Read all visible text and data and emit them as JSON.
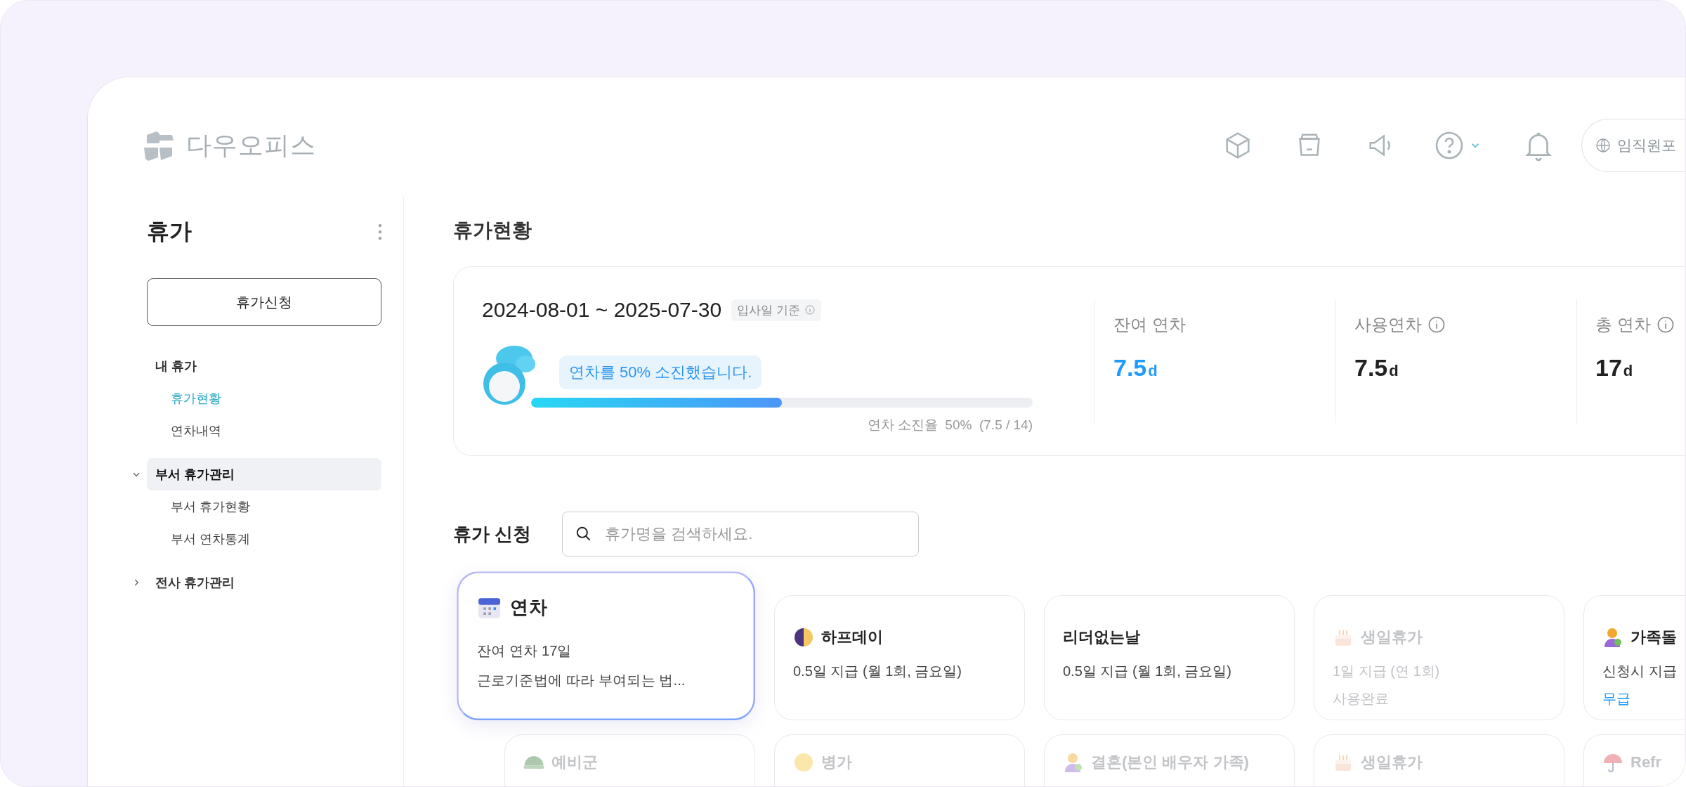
{
  "header": {
    "logo": "다우오피스",
    "portal": "임직원포"
  },
  "sidebar": {
    "title": "휴가",
    "apply_button": "휴가신청",
    "groups": [
      {
        "label": "내 휴가",
        "kind": "section",
        "children": [
          {
            "label": "휴가현황",
            "selected": true
          },
          {
            "label": "연차내역",
            "selected": false
          }
        ]
      },
      {
        "label": "부서 휴가관리",
        "kind": "toggle",
        "expanded": true,
        "selected": true,
        "children": [
          {
            "label": "부서 휴가현황",
            "selected": false
          },
          {
            "label": "부서 연차통계",
            "selected": false
          }
        ]
      },
      {
        "label": "전사 휴가관리",
        "kind": "toggle",
        "expanded": false,
        "selected": false
      }
    ]
  },
  "status": {
    "title": "휴가현황",
    "period": "2024-08-01 ~ 2025-07-30",
    "basis": "입사일 기준",
    "bubble": "연차를 50% 소진했습니다.",
    "level": 0.5,
    "reading": "연차 소진율  50%  (7.5 / 14)",
    "stats": [
      {
        "label": "잔여 연차",
        "info": false,
        "value": "7.5",
        "unit": "d",
        "highlight": true
      },
      {
        "label": "사용연차",
        "info": true,
        "value": "7.5",
        "unit": "d",
        "highlight": false
      },
      {
        "label": "총 연차",
        "info": true,
        "value": "17",
        "unit": "d",
        "highlight": false
      }
    ]
  },
  "apply": {
    "title": "휴가 신청",
    "placeholder": "휴가명을 검색하세요.",
    "cards": [
      {
        "kind": "calendar",
        "title": "연차",
        "selected": true,
        "disabled": false,
        "lines": [
          {
            "text": "잔여 연차  17일",
            "accent": false
          },
          {
            "text": "근로기준법에 따라 부여되는 법...",
            "accent": false
          }
        ]
      },
      {
        "kind": "halfmoon",
        "title": "하프데이",
        "selected": false,
        "disabled": false,
        "lines": [
          {
            "text": "0.5일 지급 (월 1회, 금요일)",
            "accent": false
          }
        ]
      },
      {
        "kind": "plain",
        "title": "리더없는날",
        "selected": false,
        "disabled": false,
        "lines": [
          {
            "text": "0.5일 지급 (월 1회, 금요일)",
            "accent": false
          }
        ]
      },
      {
        "kind": "cake",
        "title": "생일휴가",
        "selected": false,
        "disabled": true,
        "lines": [
          {
            "text": "1일 지급 (연 1회)",
            "accent": false
          },
          {
            "text": "사용완료",
            "accent": false
          }
        ]
      },
      {
        "kind": "person",
        "title": "가족돌",
        "selected": false,
        "disabled": false,
        "lines": [
          {
            "text": "신청시 지급",
            "accent": false
          },
          {
            "text": "무급",
            "accent": true
          }
        ]
      },
      {
        "kind": "helmet",
        "title": "예비군",
        "selected": false,
        "disabled": true
      },
      {
        "kind": "sick",
        "title": "병가",
        "selected": false,
        "disabled": true
      },
      {
        "kind": "person",
        "title": "결혼(본인 배우자 가족)",
        "selected": false,
        "disabled": true
      },
      {
        "kind": "cake",
        "title": "생일휴가",
        "selected": false,
        "disabled": true
      },
      {
        "kind": "umbrella",
        "title": "Refr",
        "selected": false,
        "disabled": true
      }
    ]
  }
}
